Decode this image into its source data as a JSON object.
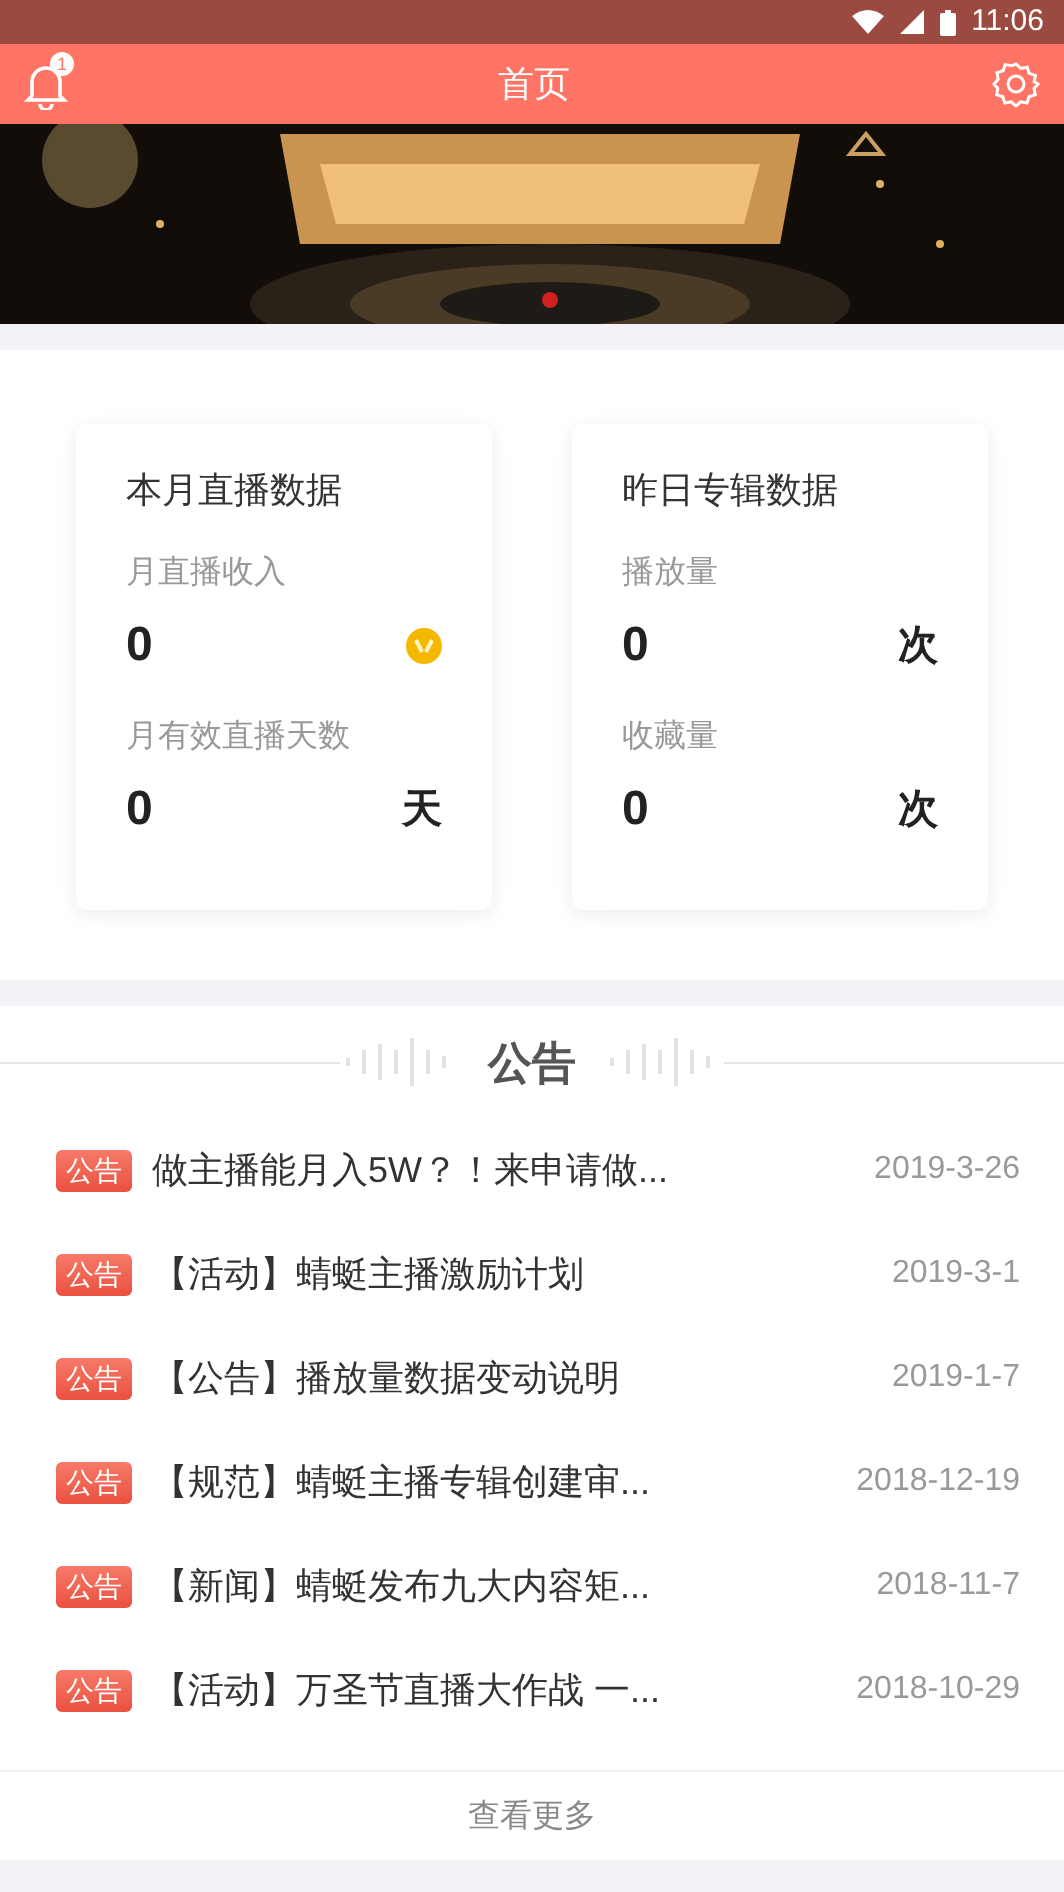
{
  "status_bar": {
    "time": "11:06"
  },
  "header": {
    "title": "首页",
    "notification_count": "1"
  },
  "stat_cards": [
    {
      "title": "本月直播数据",
      "metrics": [
        {
          "label": "月直播收入",
          "value": "0",
          "kind": "coin"
        },
        {
          "label": "月有效直播天数",
          "value": "0",
          "kind": "unit",
          "unit": "天"
        }
      ]
    },
    {
      "title": "昨日专辑数据",
      "metrics": [
        {
          "label": "播放量",
          "value": "0",
          "kind": "unit",
          "unit": "次"
        },
        {
          "label": "收藏量",
          "value": "0",
          "kind": "unit",
          "unit": "次"
        }
      ]
    }
  ],
  "announcements": {
    "heading": "公告",
    "items": [
      {
        "tag": "公告",
        "title": "做主播能月入5W？！来申请做...",
        "date": "2019-3-26"
      },
      {
        "tag": "公告",
        "title": "【活动】蜻蜓主播激励计划",
        "date": "2019-3-1"
      },
      {
        "tag": "公告",
        "title": "【公告】播放量数据变动说明",
        "date": "2019-1-7"
      },
      {
        "tag": "公告",
        "title": "【规范】蜻蜓主播专辑创建审...",
        "date": "2018-12-19"
      },
      {
        "tag": "公告",
        "title": "【新闻】蜻蜓发布九大内容矩...",
        "date": "2018-11-7"
      },
      {
        "tag": "公告",
        "title": "【活动】万圣节直播大作战 一...",
        "date": "2018-10-29"
      }
    ],
    "more": "查看更多"
  }
}
